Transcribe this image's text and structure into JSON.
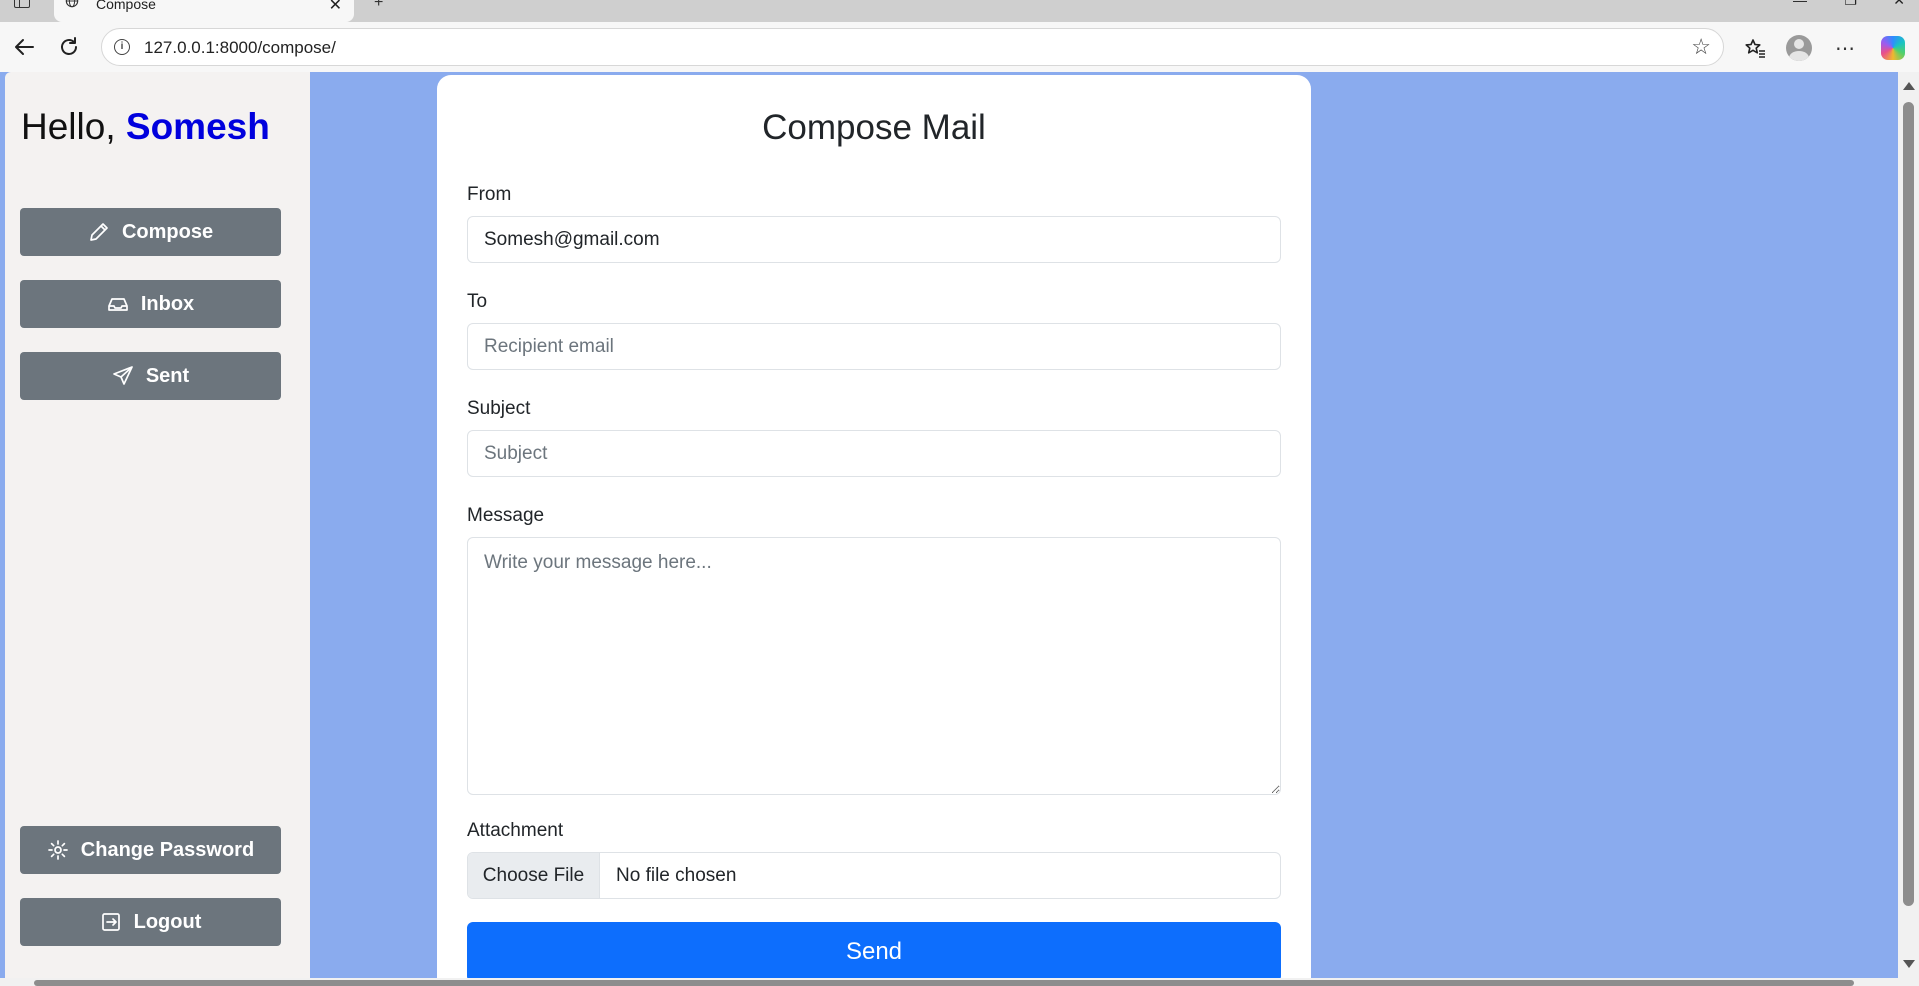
{
  "browser": {
    "tab_title": "Compose",
    "url": "127.0.0.1:8000/compose/"
  },
  "sidebar": {
    "greeting_prefix": "Hello,",
    "username": "Somesh",
    "nav": [
      {
        "label": "Compose",
        "icon": "pencil-icon"
      },
      {
        "label": "Inbox",
        "icon": "inbox-icon"
      },
      {
        "label": "Sent",
        "icon": "send-icon"
      }
    ],
    "change_password_label": "Change Password",
    "logout_label": "Logout"
  },
  "compose": {
    "title": "Compose Mail",
    "from_label": "From",
    "from_value": "Somesh@gmail.com",
    "to_label": "To",
    "to_placeholder": "Recipient email",
    "subject_label": "Subject",
    "subject_placeholder": "Subject",
    "message_label": "Message",
    "message_placeholder": "Write your message here...",
    "attachment_label": "Attachment",
    "choose_file_label": "Choose File",
    "file_status": "No file chosen",
    "send_label": "Send"
  },
  "colors": {
    "page_background": "#8aabee",
    "sidebar_background": "#f4f2f1",
    "nav_button": "#6c757d",
    "username": "#0000dd",
    "send_button": "#0d6efd"
  }
}
